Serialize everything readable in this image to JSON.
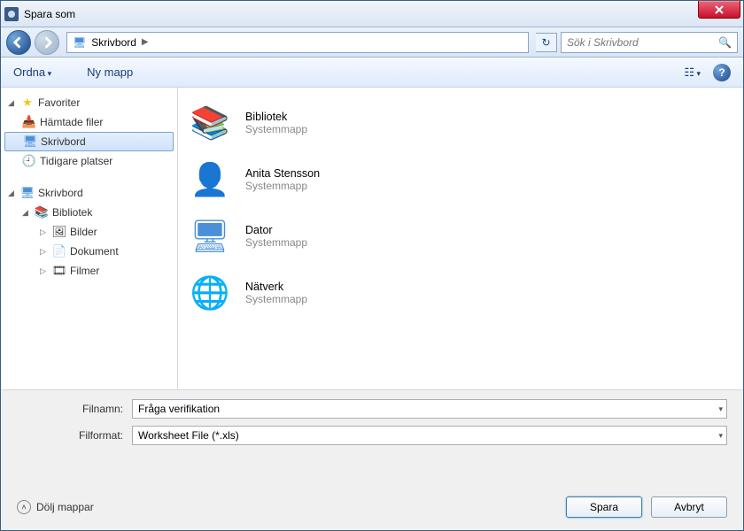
{
  "title": "Spara som",
  "nav": {
    "location": "Skrivbord",
    "search_placeholder": "Sök i Skrivbord"
  },
  "toolbar": {
    "organize": "Ordna",
    "newfolder": "Ny mapp"
  },
  "sidebar": {
    "favorites": "Favoriter",
    "downloads": "Hämtade filer",
    "desktop": "Skrivbord",
    "recent": "Tidigare platser",
    "desktop2": "Skrivbord",
    "libraries": "Bibliotek",
    "pictures": "Bilder",
    "documents": "Dokument",
    "videos": "Filmer"
  },
  "items": [
    {
      "name": "Bibliotek",
      "type": "Systemmapp",
      "icon": "libraries"
    },
    {
      "name": "Anita Stensson",
      "type": "Systemmapp",
      "icon": "user"
    },
    {
      "name": "Dator",
      "type": "Systemmapp",
      "icon": "computer"
    },
    {
      "name": "Nätverk",
      "type": "Systemmapp",
      "icon": "network"
    }
  ],
  "footer": {
    "filename_label": "Filnamn:",
    "filename_value": "Fråga verifikation",
    "format_label": "Filformat:",
    "format_value": "Worksheet File (*.xls)",
    "hide": "Dölj mappar",
    "save": "Spara",
    "cancel": "Avbryt"
  }
}
